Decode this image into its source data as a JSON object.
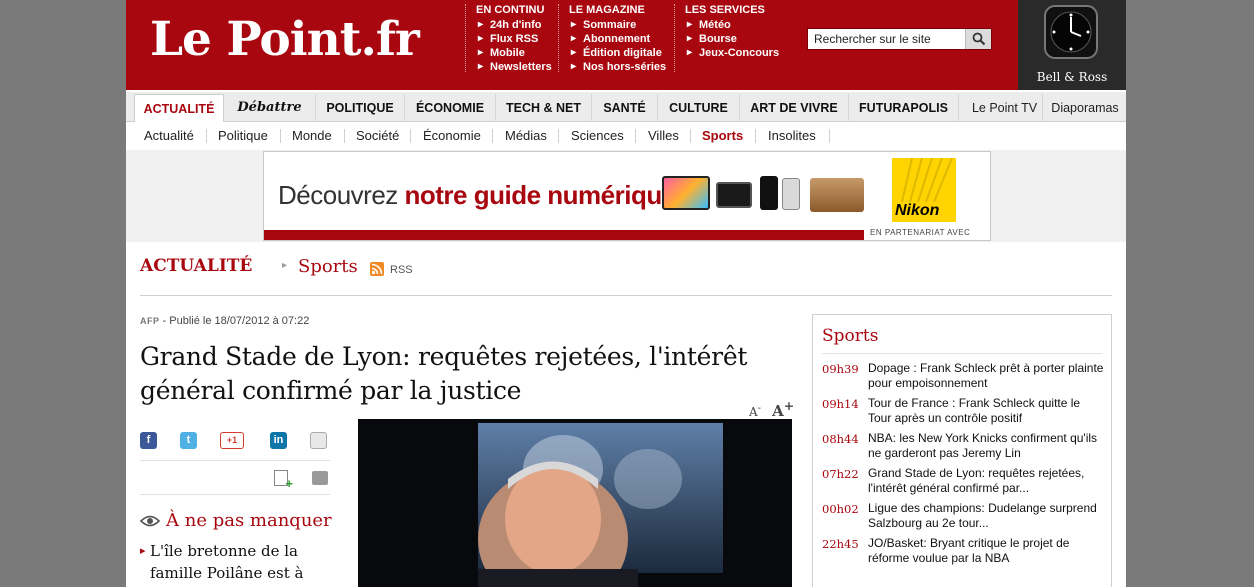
{
  "header": {
    "logo": "Le Point.fr",
    "columns": [
      {
        "title": "EN CONTINU",
        "items": [
          "24h d'info",
          "Flux RSS",
          "Mobile",
          "Newsletters"
        ]
      },
      {
        "title": "LE MAGAZINE",
        "items": [
          "Sommaire",
          "Abonnement",
          "Édition digitale",
          "Nos hors-séries"
        ]
      },
      {
        "title": "LES SERVICES",
        "items": [
          "Météo",
          "Bourse",
          "Jeux-Concours"
        ]
      }
    ],
    "search": {
      "value": "Rechercher sur le site",
      "icon": "search-icon"
    },
    "ad_brand": "Bell & Ross"
  },
  "mainnav": [
    "ACTUALITÉ",
    "Débattre",
    "POLITIQUE",
    "ÉCONOMIE",
    "TECH & NET",
    "SANTÉ",
    "CULTURE",
    "ART DE VIVRE",
    "FUTURAPOLIS",
    "Le Point TV",
    "Diaporamas"
  ],
  "subnav": [
    "Actualité",
    "Politique",
    "Monde",
    "Société",
    "Économie",
    "Médias",
    "Sciences",
    "Villes",
    "Sports",
    "Insolites"
  ],
  "banner": {
    "text_plain": "Découvrez ",
    "text_bold": "notre guide numérique",
    "brand": "Nikon",
    "partner": "EN PARTENARIAT AVEC"
  },
  "breadcrumb": {
    "section": "ACTUALITÉ",
    "current": "Sports",
    "rss": "RSS"
  },
  "article": {
    "source": "AFP",
    "published": " - Publié le 18/07/2012 à 07:22",
    "headline": "Grand Stade de Lyon: requêtes rejetées, l'intérêt général confirmé par la justice",
    "font_small": "A",
    "font_large": "A",
    "share_gplus": "+1"
  },
  "missing": {
    "title": "À ne pas manquer",
    "item": "L'île bretonne de la famille Poilâne est à"
  },
  "sidebar": {
    "title": "Sports",
    "items": [
      {
        "time": "09h39",
        "text": "Dopage : Frank Schleck prêt à porter plainte pour empoisonnement"
      },
      {
        "time": "09h14",
        "text": "Tour de France : Frank Schleck quitte le Tour après un contrôle positif"
      },
      {
        "time": "08h44",
        "text": "NBA: les New York Knicks confirment qu'ils ne garderont pas Jeremy Lin"
      },
      {
        "time": "07h22",
        "text": "Grand Stade de Lyon: requêtes rejetées, l'intérêt général confirmé par..."
      },
      {
        "time": "00h02",
        "text": "Ligue des champions: Dudelange surprend Salzbourg au 2e tour..."
      },
      {
        "time": "22h45",
        "text": "JO/Basket: Bryant critique le projet de réforme voulue par la NBA"
      }
    ]
  },
  "colors": {
    "brand_red": "#a8070f",
    "header_dark": "#2a2a2a",
    "page_bg": "#7a7a7a"
  }
}
